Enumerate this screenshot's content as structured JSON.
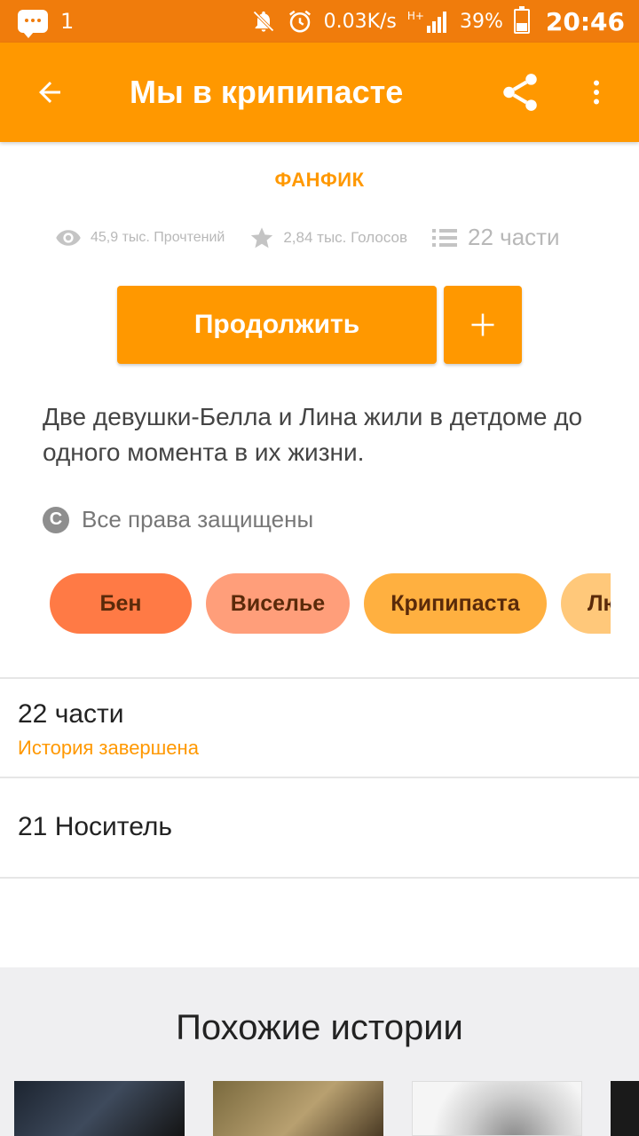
{
  "status_bar": {
    "notification_count": "1",
    "network_speed": "0.03K/s",
    "network_type": "H+",
    "battery": "39%",
    "time": "20:46"
  },
  "app_bar": {
    "title": "Мы в крипипасте",
    "icons": [
      "back-arrow-icon",
      "share-icon",
      "more-vert-icon"
    ]
  },
  "story": {
    "kind": "ФАНФИК",
    "reads": "45,9 тыс. Прочтений",
    "votes": "2,84 тыс. Голосов",
    "parts": "22 части",
    "continue_label": "Продолжить",
    "add_label": "+",
    "description": "Две девушки-Белла и Лина жили в детдоме до одного момента в их жизни.",
    "copyright": "Все права защищены"
  },
  "tags": [
    {
      "label": "Бен",
      "color": "#ff7a45"
    },
    {
      "label": "Виселье",
      "color": "#ff9e7a"
    },
    {
      "label": "Крипипаста",
      "color": "#ffb040"
    },
    {
      "label": "Лю",
      "color": "#ffc87a"
    }
  ],
  "table_of_contents": {
    "parts_count": "22 части",
    "status": "История завершена",
    "latest_part": "21 Носитель"
  },
  "similar": {
    "title": "Похожие истории"
  },
  "colors": {
    "accent": "#ff9800",
    "status_bar": "#f07c0c"
  }
}
